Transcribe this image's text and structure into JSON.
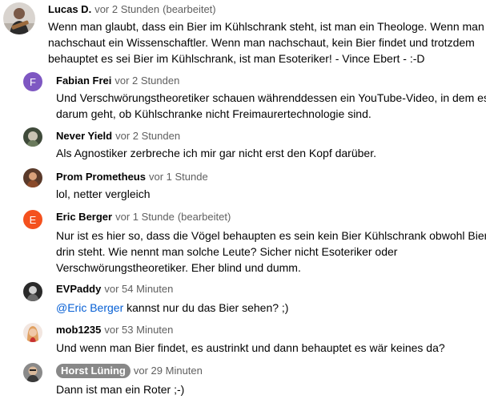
{
  "colors": {
    "text": "#030303",
    "meta": "#606060",
    "mention": "#065fd4",
    "avatar_fabian": "#7e57c2",
    "avatar_eric": "#f4511e",
    "chip_bg": "#888888"
  },
  "comments": [
    {
      "author": "Lucas D.",
      "time": "vor 2 Stunden",
      "edited": "(bearbeitet)",
      "avatar_icon": "user-photo-avatar",
      "lines": [
        "Wenn man glaubt, dass ein Bier im Kühlschrank steht, ist man ein Theologe. Wenn man",
        "nachschaut ein Wissenschaftler. Wenn man nachschaut, kein Bier findet und trotzdem",
        "behauptet es sei Bier im Kühlschrank, ist man Esoteriker! - Vince Ebert - :-D"
      ]
    },
    {
      "author": "Fabian Frei",
      "time": "vor 2 Stunden",
      "avatar_letter": "F",
      "lines": [
        "Und Verschwörungstheoretiker schauen währenddessen ein YouTube-Video, in dem es",
        "darum geht, ob Kühlschranke nicht  Freimaurertechnologie sind."
      ]
    },
    {
      "author": "Never Yield",
      "time": "vor 2 Stunden",
      "avatar_icon": "user-photo-avatar",
      "lines": [
        "Als Agnostiker zerbreche ich mir gar nicht erst den Kopf darüber."
      ]
    },
    {
      "author": "Prom Prometheus",
      "time": "vor 1 Stunde",
      "avatar_icon": "user-photo-avatar",
      "lines": [
        "lol, netter vergleich"
      ]
    },
    {
      "author": "Eric Berger",
      "time": "vor 1 Stunde",
      "edited": "(bearbeitet)",
      "avatar_letter": "E",
      "lines": [
        "Nur ist es hier so, dass die Vögel behaupten es sein kein Bier Kühlschrank obwohl Bier",
        "drin steht. Wie nennt man solche Leute? Sicher nicht Esoteriker oder",
        "Verschwörungstheoretiker. Eher blind und dumm."
      ]
    },
    {
      "author": "EVPaddy",
      "time": "vor 54 Minuten",
      "avatar_icon": "user-photo-avatar",
      "mention": "@Eric Berger",
      "lines": [
        " kannst nur du das Bier sehen? ;)"
      ]
    },
    {
      "author": "mob1235",
      "time": "vor 53 Minuten",
      "avatar_icon": "user-photo-avatar",
      "lines": [
        "Und wenn man Bier findet, es austrinkt und dann behauptet es wär keines da?"
      ]
    },
    {
      "author": "Horst Lüning",
      "time": "vor 29 Minuten",
      "avatar_icon": "user-photo-avatar",
      "lines": [
        "Dann ist man ein Roter ;-)"
      ]
    }
  ]
}
